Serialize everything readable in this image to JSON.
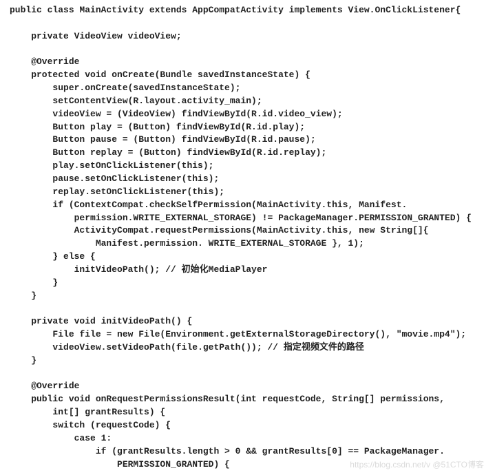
{
  "code": {
    "l01": "public class MainActivity extends AppCompatActivity implements View.OnClickListener{",
    "l02": "",
    "l03": "    private VideoView videoView;",
    "l04": "",
    "l05": "    @Override",
    "l06": "    protected void onCreate(Bundle savedInstanceState) {",
    "l07": "        super.onCreate(savedInstanceState);",
    "l08": "        setContentView(R.layout.activity_main);",
    "l09": "        videoView = (VideoView) findViewById(R.id.video_view);",
    "l10": "        Button play = (Button) findViewById(R.id.play);",
    "l11": "        Button pause = (Button) findViewById(R.id.pause);",
    "l12": "        Button replay = (Button) findViewById(R.id.replay);",
    "l13": "        play.setOnClickListener(this);",
    "l14": "        pause.setOnClickListener(this);",
    "l15": "        replay.setOnClickListener(this);",
    "l16": "        if (ContextCompat.checkSelfPermission(MainActivity.this, Manifest.",
    "l17": "            permission.WRITE_EXTERNAL_STORAGE) != PackageManager.PERMISSION_GRANTED) {",
    "l18": "            ActivityCompat.requestPermissions(MainActivity.this, new String[]{",
    "l19": "                Manifest.permission. WRITE_EXTERNAL_STORAGE }, 1);",
    "l20": "        } else {",
    "l21": "            initVideoPath(); // 初始化MediaPlayer",
    "l22": "        }",
    "l23": "    }",
    "l24": "",
    "l25": "    private void initVideoPath() {",
    "l26": "        File file = new File(Environment.getExternalStorageDirectory(), \"movie.mp4\");",
    "l27": "        videoView.setVideoPath(file.getPath()); // 指定视频文件的路径",
    "l28": "    }",
    "l29": "",
    "l30": "    @Override",
    "l31": "    public void onRequestPermissionsResult(int requestCode, String[] permissions,",
    "l32": "        int[] grantResults) {",
    "l33": "        switch (requestCode) {",
    "l34": "            case 1:",
    "l35": "                if (grantResults.length > 0 && grantResults[0] == PackageManager.",
    "l36": "                    PERMISSION_GRANTED) {"
  },
  "watermark": "https://blog.csdn.net/v @51CTO博客"
}
